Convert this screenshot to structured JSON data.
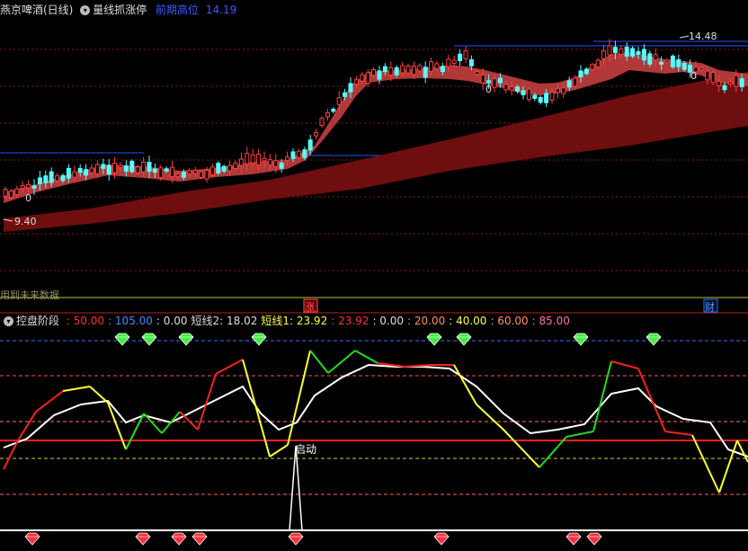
{
  "main_panel": {
    "stock_name": "燕京啤酒(日线)",
    "indicator_name": "量线抓涨停",
    "key_label": "前期高位",
    "key_value": "14.19",
    "price_high_label": "14.48",
    "price_low_label": "9.40",
    "bar_zero_labels": [
      "0",
      "0",
      "0"
    ],
    "future_data_notice": "用到未来数据"
  },
  "marker_strip": {
    "rise_marker": "涨",
    "finance_marker": "财"
  },
  "sub_panel": {
    "indicator_name": "控盘阶段",
    "values": [
      {
        "text": ": 50.00",
        "color": "#ff3030"
      },
      {
        "text": ": 105.00",
        "color": "#3a8cff"
      },
      {
        "text": ": 0.00",
        "color": "#dddddd"
      },
      {
        "text": "短线2: 18.02",
        "color": "#dddddd"
      },
      {
        "text": "短线1: 23.92",
        "color": "#ffff40"
      },
      {
        "text": ": 23.92",
        "color": "#ff3030"
      },
      {
        "text": ": 0.00",
        "color": "#dddddd"
      },
      {
        "text": ": 20.00",
        "color": "#ff9060"
      },
      {
        "text": ": 40.00",
        "color": "#ffff40"
      },
      {
        "text": ": 60.00",
        "color": "#ff9060"
      },
      {
        "text": ": 85.00",
        "color": "#ff70b0"
      }
    ],
    "start_label": "启动"
  },
  "colors": {
    "up": "#ff4040",
    "down": "#54ffff",
    "ribbon": "#7a1010",
    "grid": "#8a1818",
    "sub_grid": "#ff5050",
    "level_blue": "#2a50ff",
    "green_gem": "#44ee44",
    "red_gem": "#ff3040"
  }
}
